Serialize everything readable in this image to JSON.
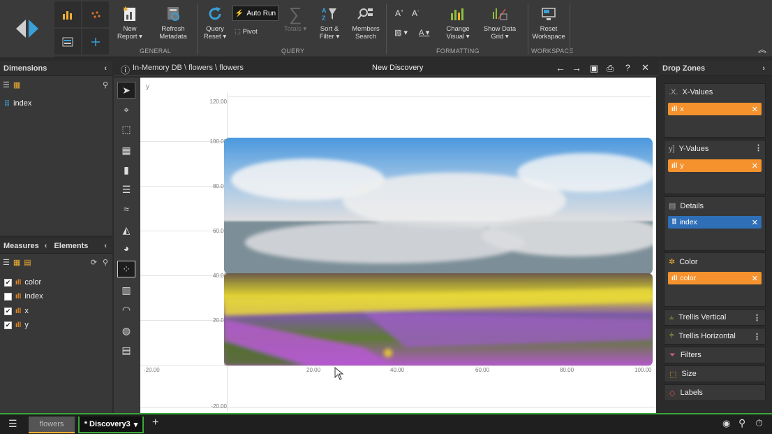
{
  "ribbon": {
    "new_report": "New\nReport ▾",
    "refresh_metadata": "Refresh\nMetadata",
    "query_reset": "Query\nReset ▾",
    "auto_run": "Auto Run",
    "pivot": "Pivot",
    "totals": "Totals ▾",
    "sort_filter": "Sort &\nFilter ▾",
    "members_search": "Members\nSearch",
    "change_visual": "Change\nVisual ▾",
    "show_data_grid": "Show Data\nGrid ▾",
    "reset_workspace": "Reset\nWorkspace",
    "group_general": "GENERAL",
    "group_query": "QUERY",
    "group_formatting": "FORMATTING",
    "group_workspace": "WORKSPACE"
  },
  "dimensions": {
    "title": "Dimensions",
    "items": [
      "index"
    ]
  },
  "measures": {
    "title": "Measures",
    "elements_tab": "Elements",
    "items": [
      {
        "label": "color",
        "checked": true
      },
      {
        "label": "index",
        "checked": false
      },
      {
        "label": "x",
        "checked": true
      },
      {
        "label": "y",
        "checked": true
      }
    ]
  },
  "canvas": {
    "breadcrumb": "In-Memory DB \\ flowers \\ flowers",
    "title": "New Discovery",
    "y_axis_title": "y",
    "y_ticks": [
      "120.00",
      "100.00",
      "80.00",
      "60.00",
      "40.00",
      "20.00",
      "-20.00"
    ],
    "x_ticks": [
      "-20.00",
      "20.00",
      "40.00",
      "60.00",
      "80.00",
      "100.00"
    ]
  },
  "drop_zones": {
    "title": "Drop Zones",
    "x_values": {
      "title": "X-Values",
      "pill": "x"
    },
    "y_values": {
      "title": "Y-Values",
      "pill": "y"
    },
    "details": {
      "title": "Details",
      "pill": "index"
    },
    "color": {
      "title": "Color",
      "pill": "color"
    },
    "trellis_vertical": "Trellis Vertical",
    "trellis_horizontal": "Trellis Horizontal",
    "filters": "Filters",
    "size": "Size",
    "labels": "Labels"
  },
  "bottom": {
    "tab_flowers": "flowers",
    "tab_discovery": "* Discovery3"
  },
  "colors": {
    "accent_orange": "#f5922e",
    "accent_blue": "#2f6fb7",
    "accent_green": "#3aa83a"
  }
}
